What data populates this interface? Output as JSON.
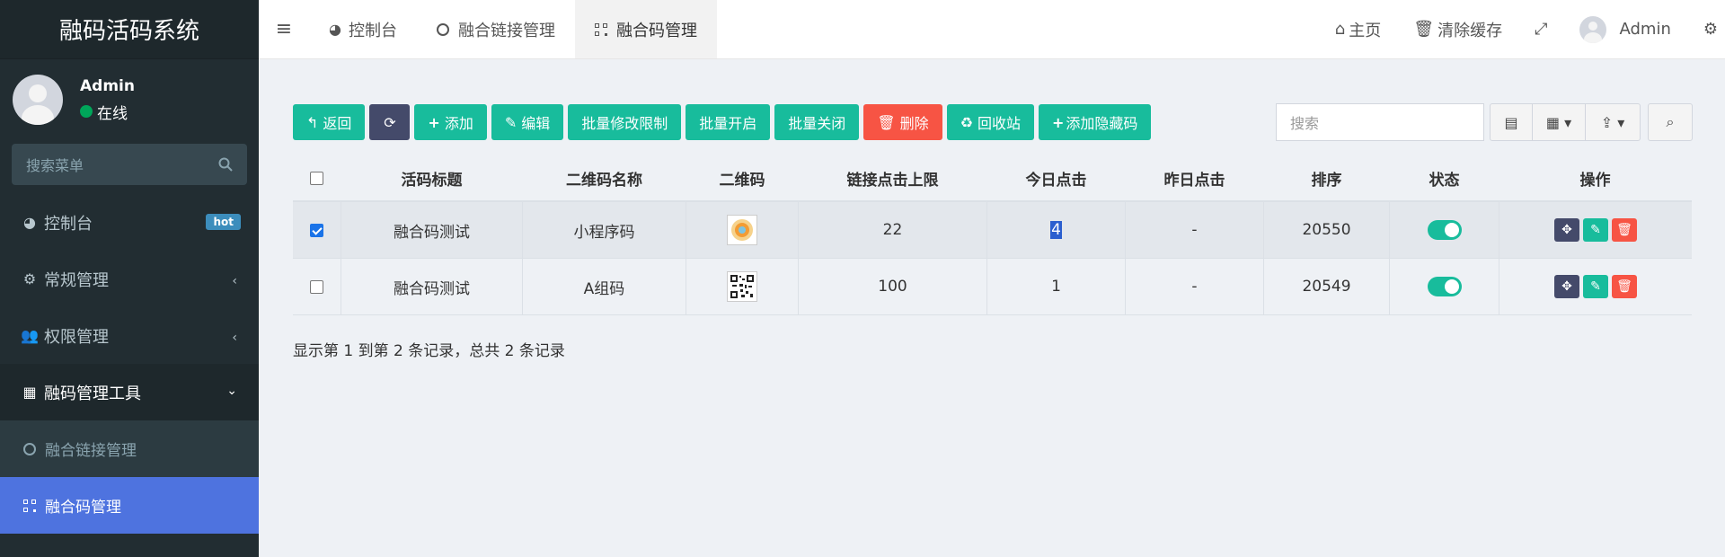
{
  "sidebar": {
    "brand": "融码活码系统",
    "user": {
      "name": "Admin",
      "status": "在线"
    },
    "search_placeholder": "搜索菜单",
    "items": [
      {
        "label": "控制台",
        "badge": "hot"
      },
      {
        "label": "常规管理"
      },
      {
        "label": "权限管理"
      },
      {
        "label": "融码管理工具"
      }
    ],
    "subitems": [
      {
        "label": "融合链接管理"
      },
      {
        "label": "融合码管理"
      }
    ]
  },
  "navbar": {
    "tabs": [
      {
        "label": "控制台"
      },
      {
        "label": "融合链接管理"
      },
      {
        "label": "融合码管理"
      }
    ],
    "home": "主页",
    "clear_cache": "清除缓存",
    "user": "Admin"
  },
  "toolbar": {
    "back": "返回",
    "add": "添加",
    "edit": "编辑",
    "batch_limit": "批量修改限制",
    "batch_on": "批量开启",
    "batch_off": "批量关闭",
    "delete": "删除",
    "recycle": "回收站",
    "add_hidden": "添加隐藏码",
    "search_placeholder": "搜索"
  },
  "table": {
    "headers": [
      "活码标题",
      "二维码名称",
      "二维码",
      "链接点击上限",
      "今日点击",
      "昨日点击",
      "排序",
      "状态",
      "操作"
    ],
    "rows": [
      {
        "title": "融合码测试",
        "name": "小程序码",
        "limit": "22",
        "today": "4",
        "yesterday": "-",
        "order": "20550",
        "checked": true
      },
      {
        "title": "融合码测试",
        "name": "A组码",
        "limit": "100",
        "today": "1",
        "yesterday": "-",
        "order": "20549",
        "checked": false
      }
    ]
  },
  "pagination": {
    "summary": "显示第 1 到第 2 条记录，总共 2 条记录"
  },
  "colors": {
    "green": "#18bc9c",
    "dark": "#444a6a",
    "red": "#f75444",
    "sidebar": "#222d32",
    "active": "#4e73df"
  }
}
